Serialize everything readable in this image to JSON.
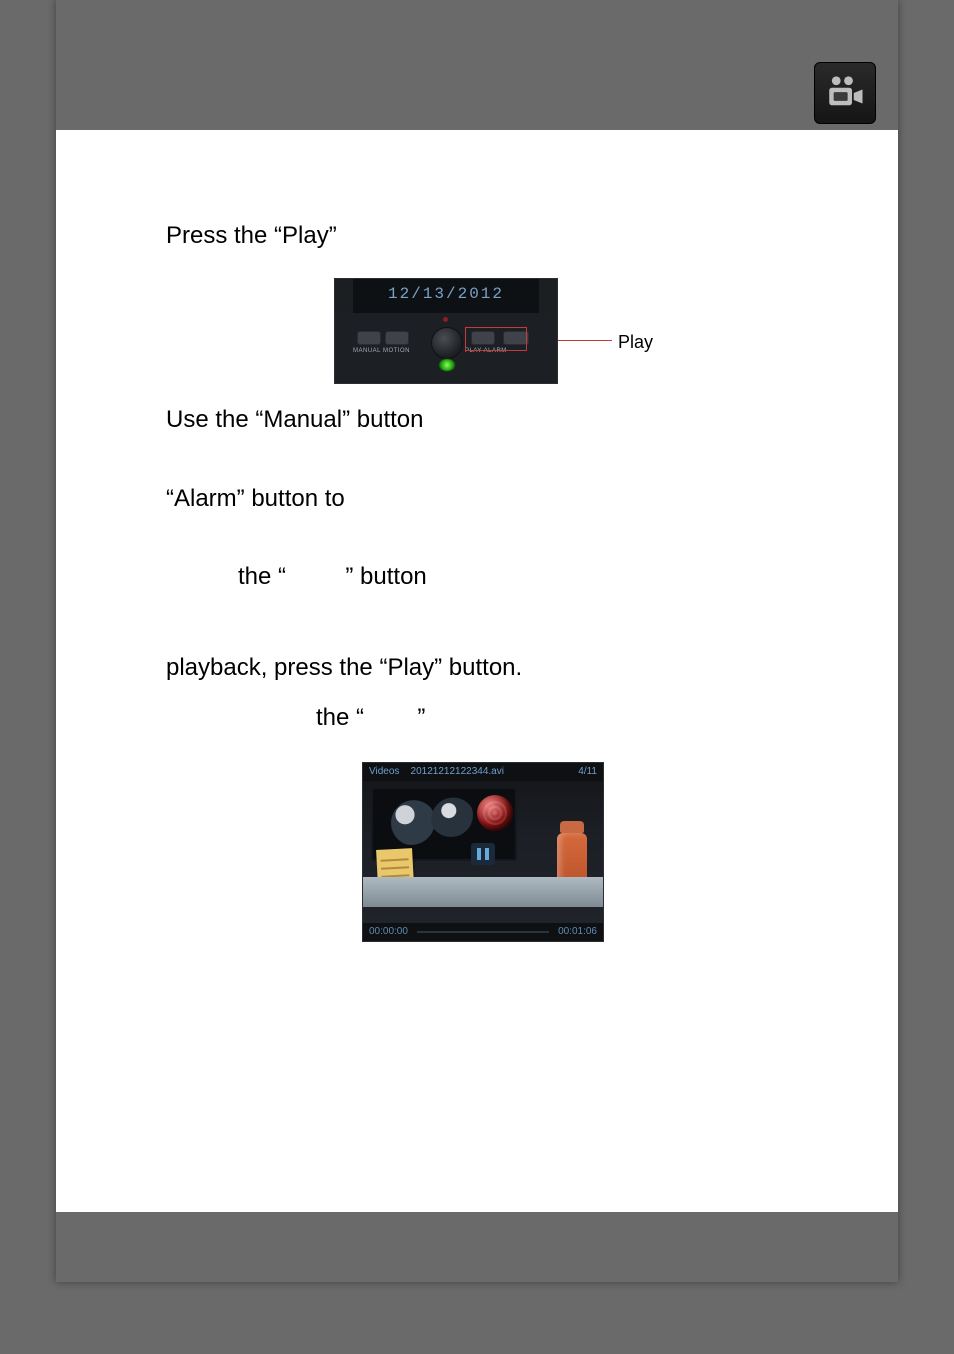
{
  "corner_icon_name": "camcorder-icon",
  "body": {
    "line1": "Press the “Play”",
    "line2": "Use the “Manual” button",
    "line3": "“Alarm” button to",
    "line4_pre": "the “",
    "line4_post": "” button",
    "line5": "playback, press the “Play” button.",
    "line6_pre": "the “",
    "line6_post": "”"
  },
  "figure1": {
    "lcd_text": "12/13/2012",
    "btn_labels_left": "MANUAL  MOTION",
    "btn_labels_right": "PLAY      ALARM",
    "callout_label": "Play"
  },
  "figure2": {
    "title_left": "Videos",
    "filename": "20121212122344.avi",
    "counter": "4/11",
    "time_start": "00:00:00",
    "time_end": "00:01:06"
  }
}
